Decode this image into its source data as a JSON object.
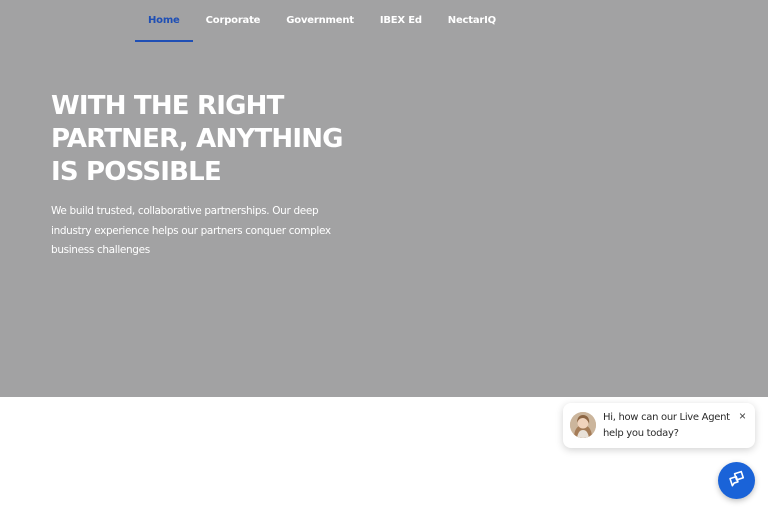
{
  "nav": {
    "items": [
      {
        "label": "Home",
        "active": true
      },
      {
        "label": "Corporate",
        "active": false
      },
      {
        "label": "Government",
        "active": false
      },
      {
        "label": "IBEX Ed",
        "active": false
      },
      {
        "label": "NectarIQ",
        "active": false
      }
    ]
  },
  "hero": {
    "headline": "WITH THE RIGHT PARTNER, ANYTHING IS POSSIBLE",
    "subtext": "We build trusted, collaborative partnerships. Our deep industry experience helps our partners conquer complex business challenges",
    "background_color": "#a2a2a3"
  },
  "chat": {
    "message": "Hi, how can our Live Agent help you today?",
    "close_icon": "×",
    "avatar": "agent-avatar",
    "launcher_icon": "chat-icon",
    "launcher_color": "#1a63d8"
  },
  "colors": {
    "accent": "#1f4fb5"
  }
}
